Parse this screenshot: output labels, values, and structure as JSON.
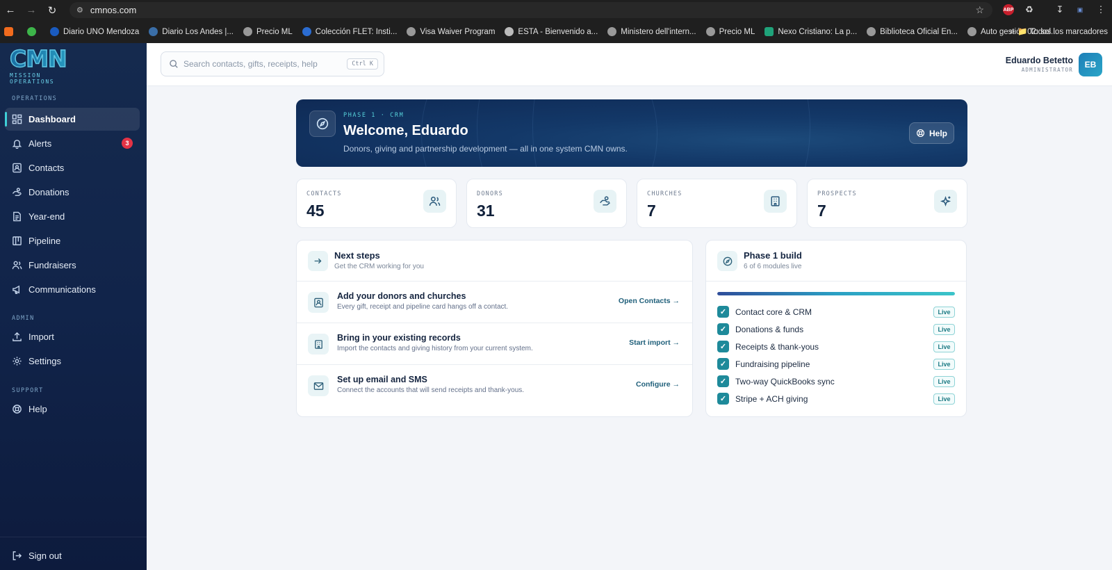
{
  "browser": {
    "url": "cmnos.com",
    "bookmarks": [
      "Diario UNO Mendoza",
      "Diario Los Andes |...",
      "Precio ML",
      "Colección FLET: Insti...",
      "Visa Waiver Program",
      "ESTA - Bienvenido a...",
      "Ministero dell'intern...",
      "Precio ML",
      "Nexo Cristiano: La p...",
      "Biblioteca Oficial En...",
      "Auto gestión 02: sol..."
    ],
    "bookmarks_folder": "Todos los marcadores",
    "abp_label": "ABP"
  },
  "brand": {
    "logo_text": "CMN",
    "subtitle": "MISSION OPERATIONS"
  },
  "sidebar": {
    "operations_label": "OPERATIONS",
    "admin_label": "ADMIN",
    "support_label": "SUPPORT",
    "items": [
      {
        "label": "Dashboard",
        "icon": "dashboard-icon"
      },
      {
        "label": "Alerts",
        "icon": "bell-icon",
        "badge": "3"
      },
      {
        "label": "Contacts",
        "icon": "contact-icon"
      },
      {
        "label": "Donations",
        "icon": "donation-icon"
      },
      {
        "label": "Year-end",
        "icon": "document-icon"
      },
      {
        "label": "Pipeline",
        "icon": "pipeline-icon"
      },
      {
        "label": "Fundraisers",
        "icon": "users-icon"
      },
      {
        "label": "Communications",
        "icon": "megaphone-icon"
      }
    ],
    "admin_items": [
      {
        "label": "Import",
        "icon": "upload-icon"
      },
      {
        "label": "Settings",
        "icon": "gear-icon"
      }
    ],
    "support_items": [
      {
        "label": "Help",
        "icon": "lifebuoy-icon"
      }
    ],
    "sign_out": "Sign out"
  },
  "topbar": {
    "search_placeholder": "Search contacts, gifts, receipts, help",
    "shortcut": "Ctrl K",
    "user_name": "Eduardo Betetto",
    "user_role": "ADMINISTRATOR",
    "initials": "EB"
  },
  "hero": {
    "eyebrow": "PHASE 1 · CRM",
    "title": "Welcome, Eduardo",
    "description": "Donors, giving and partnership development — all in one system CMN owns.",
    "help": "Help"
  },
  "stats": [
    {
      "label": "CONTACTS",
      "value": "45",
      "icon": "users-icon"
    },
    {
      "label": "DONORS",
      "value": "31",
      "icon": "donation-icon"
    },
    {
      "label": "CHURCHES",
      "value": "7",
      "icon": "building-icon"
    },
    {
      "label": "PROSPECTS",
      "value": "7",
      "icon": "sparkle-icon"
    }
  ],
  "next_steps": {
    "title": "Next steps",
    "subtitle": "Get the CRM working for you",
    "items": [
      {
        "title": "Add your donors and churches",
        "desc": "Every gift, receipt and pipeline card hangs off a contact.",
        "action": "Open Contacts →"
      },
      {
        "title": "Bring in your existing records",
        "desc": "Import the contacts and giving history from your current system.",
        "action": "Start import →"
      },
      {
        "title": "Set up email and SMS",
        "desc": "Connect the accounts that will send receipts and thank-yous.",
        "action": "Configure →"
      }
    ]
  },
  "phase": {
    "title": "Phase 1 build",
    "subtitle": "6 of 6 modules live",
    "progress": 1.0,
    "modules": [
      {
        "name": "Contact core & CRM",
        "status": "Live"
      },
      {
        "name": "Donations & funds",
        "status": "Live"
      },
      {
        "name": "Receipts & thank-yous",
        "status": "Live"
      },
      {
        "name": "Fundraising pipeline",
        "status": "Live"
      },
      {
        "name": "Two-way QuickBooks sync",
        "status": "Live"
      },
      {
        "name": "Stripe + ACH giving",
        "status": "Live"
      }
    ]
  },
  "colors": {
    "accent": "#2aa5c7",
    "sidebar": "#13284d",
    "badge": "#e53345"
  }
}
